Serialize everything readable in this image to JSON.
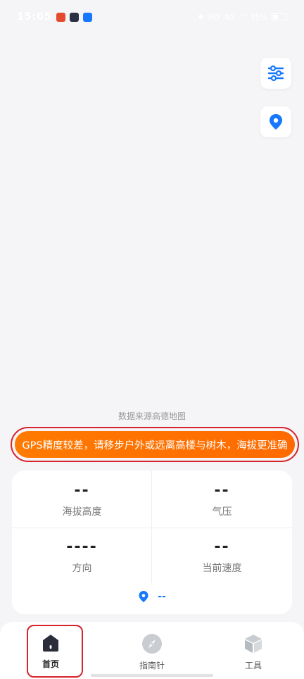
{
  "status_bar": {
    "time": "15:05",
    "icons": [
      "app-badge-red",
      "app-badge-dark",
      "alipay-badge",
      "bluetooth-icon",
      "signal-icon",
      "wifi-icon",
      "battery-icon"
    ],
    "network_top": "HD",
    "network_bottom": "4G",
    "battery": "35%"
  },
  "map": {
    "data_source": "数据来源高德地图",
    "buttons": [
      "filter-settings-icon",
      "location-pin-icon"
    ]
  },
  "gps_warning": "GPS精度较差，请移步户外或远离高楼与树木，海拔更准确",
  "stats": {
    "altitude": {
      "value": "--",
      "label": "海拔高度"
    },
    "pressure": {
      "value": "--",
      "label": "气压"
    },
    "direction": {
      "value": "----",
      "label": "方向"
    },
    "speed": {
      "value": "--",
      "label": "当前速度"
    },
    "location": "--"
  },
  "nav": {
    "home": "首页",
    "compass": "指南针",
    "tools": "工具"
  },
  "colors": {
    "accent": "#1677ff",
    "warning": "#ff7a00",
    "highlight": "#d7232c"
  }
}
